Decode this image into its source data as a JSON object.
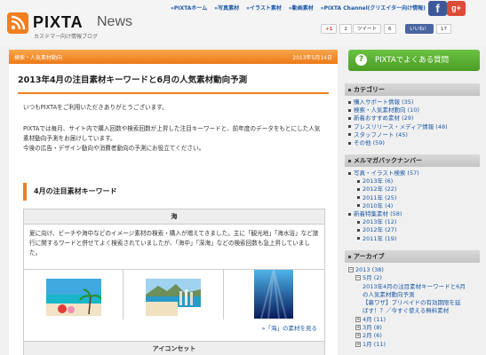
{
  "header": {
    "brand": "PIXTA",
    "brand2": "News",
    "tagline": "カステマー向け情報ブログ",
    "nav": [
      "»PIXTAホーム",
      "»写真素材",
      "»イラスト素材",
      "»動画素材",
      "»PIXTA Channel(クリエイター向け情報)"
    ],
    "facebook": "f",
    "google": "g+"
  },
  "share": {
    "gplus_label": "+1",
    "gplus_count": "2",
    "tweet_label": "ツイート",
    "tweet_count": "6",
    "like_label": "いいね！",
    "like_count": "17"
  },
  "post": {
    "category": "検索・人気素材動向",
    "date": "2013年5月14日",
    "title": "2013年4月の注目素材キーワードと6月の人気素材動向予測",
    "p1": "いつもPIXTAをご利用いただきありがとうございます。",
    "p2": "PIXTAでは毎月、サイト内で購入回数や検索回数が上昇した注目キーワードと、前年度のデータをもとにした人気素材動向予測をお届けしています。",
    "p3": "今後の広告・デザイン動向や消費者動向の予測にお役立てください。",
    "h2": "4月の注目素材キーワード",
    "table_head": "海",
    "table_text": "夏に向け、ビーチや海中などのイメージ素材の検索・購入が増えてきました。主に「観光地」「海水浴」など旅行に関するワードと併せてよく検索されていましたが、「海中」「深海」などの検索回数も急上昇していました。",
    "more": "»「海」の素材を見る",
    "table_head2": "アイコンセット"
  },
  "sidebar": {
    "faq": "PIXTAでよくある質問",
    "faq_icon": "?",
    "cat_title": "カテゴリー",
    "categories": [
      "購入サポート情報 (35)",
      "検索・人気素材動向 (10)",
      "新着おすすめ素材 (29)",
      "プレスリリース・メディア情報 (48)",
      "スタッフノート (45)",
      "その他 (59)"
    ],
    "mm_title": "メルマガバックナンバー",
    "mm_items": [
      "写真・イラスト検索 (57)",
      "新着特集素材 (58)"
    ],
    "mm_sub1": [
      "2013年 (6)",
      "2012年 (22)",
      "2011年 (25)",
      "2010年 (4)"
    ],
    "mm_sub2": [
      "2013年 (12)",
      "2012年 (27)",
      "2011年 (19)"
    ],
    "arch_title": "アーカイブ",
    "arch_year": "2013 (38)",
    "arch_month": "5月 (2)",
    "arch_posts": [
      "2013年4月の注目素材キーワードと6月の人気素材動向予測",
      "【裏ワザ】プリペイドの有効期限を延ばす！？／今すぐ使える無料素材"
    ],
    "arch_months": [
      "4月 (11)",
      "3月 (8)",
      "2月 (6)",
      "1月 (11)"
    ],
    "box_minus": "−",
    "box_plus": "+"
  }
}
